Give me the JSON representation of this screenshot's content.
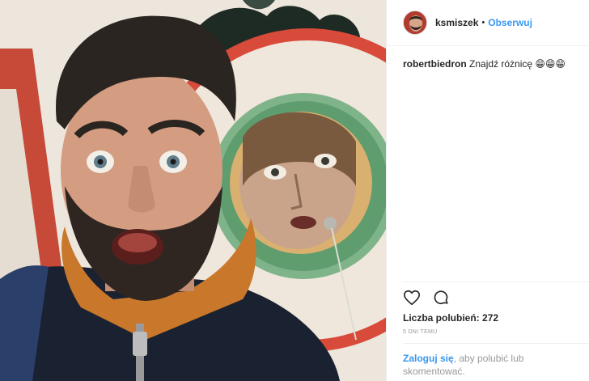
{
  "post": {
    "author": "ksmiszek",
    "separator": "•",
    "follow_label": "Obserwuj",
    "caption_user": "robertbiedron",
    "caption_text": "Znajdź różnicę 😁😁😁",
    "likes_label": "Liczba polubień:",
    "likes_count": "272",
    "timestamp": "5 DNI TEMU",
    "login_link": "Zaloguj się",
    "login_text": ", aby polubić lub skomentować."
  },
  "icons": {
    "like": "heart-icon",
    "comment": "comment-icon"
  },
  "colors": {
    "link": "#3897f0",
    "text": "#262626",
    "muted": "#999999",
    "border": "#efefef"
  }
}
